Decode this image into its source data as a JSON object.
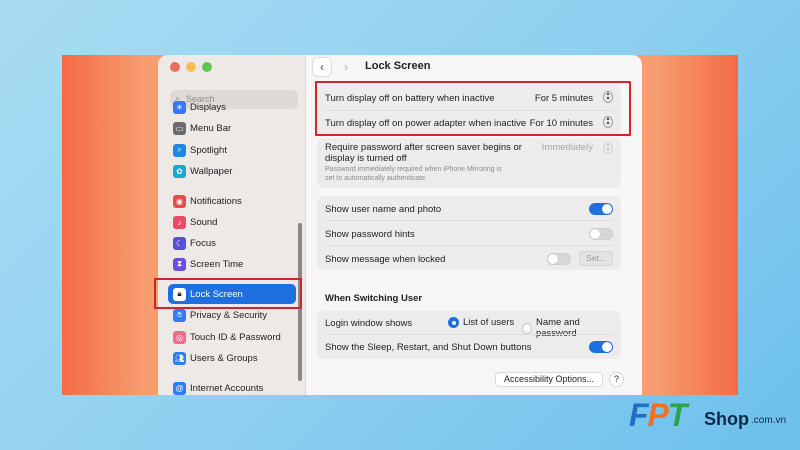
{
  "window": {
    "title": "Lock Screen",
    "search_placeholder": "Search"
  },
  "sidebar": {
    "items": [
      {
        "label": "Displays",
        "icon": "sun-icon",
        "color": "#2f7cf6"
      },
      {
        "label": "Menu Bar",
        "icon": "menubar-icon",
        "color": "#6b6b6b"
      },
      {
        "label": "Spotlight",
        "icon": "magnifier-icon",
        "color": "#1e88e5"
      },
      {
        "label": "Wallpaper",
        "icon": "flower-icon",
        "color": "#18a7d6"
      },
      {
        "label": "Notifications",
        "icon": "bell-icon",
        "color": "#e94a4a"
      },
      {
        "label": "Sound",
        "icon": "speaker-icon",
        "color": "#ec4a6a"
      },
      {
        "label": "Focus",
        "icon": "moon-icon",
        "color": "#5b4fd6"
      },
      {
        "label": "Screen Time",
        "icon": "hourglass-icon",
        "color": "#6a4fd6"
      },
      {
        "label": "Lock Screen",
        "icon": "lock-icon",
        "color": "#1e1e1e",
        "active": true
      },
      {
        "label": "Privacy & Security",
        "icon": "hand-icon",
        "color": "#2f7cf6"
      },
      {
        "label": "Touch ID & Password",
        "icon": "fingerprint-icon",
        "color": "#ef6d8a"
      },
      {
        "label": "Users & Groups",
        "icon": "users-icon",
        "color": "#2f7cf6"
      },
      {
        "label": "Internet Accounts",
        "icon": "at-icon",
        "color": "#2f7cf6"
      }
    ]
  },
  "display": {
    "battery_label": "Turn display off on battery when inactive",
    "battery_value": "For 5 minutes",
    "adapter_label": "Turn display off on power adapter when inactive",
    "adapter_value": "For 10 minutes"
  },
  "password": {
    "label_line1": "Require password after screen saver begins or",
    "label_line2": "display is turned off",
    "value": "Immediately",
    "note_line1": "Password immediately required when iPhone Mirroring is",
    "note_line2": "set to automatically authenticate."
  },
  "toggles": {
    "show_user": {
      "label": "Show user name and photo",
      "on": true
    },
    "show_hints": {
      "label": "Show password hints",
      "on": false
    },
    "show_message": {
      "label": "Show message when locked",
      "on": false,
      "set_label": "Set..."
    }
  },
  "switching": {
    "title": "When Switching User",
    "login_label": "Login window shows",
    "option_list": "List of users",
    "option_name": "Name and password",
    "selected": "List of users",
    "buttons_label": "Show the Sleep, Restart, and Shut Down buttons",
    "buttons_on": true
  },
  "footer": {
    "accessibility_label": "Accessibility Options...",
    "help_label": "?"
  },
  "brand": {
    "f": "F",
    "p": "P",
    "t": "T",
    "shop": "Shop",
    "domain": ".com.vn"
  },
  "colors": {
    "accent": "#1e6fe0",
    "highlight": "#d6222b"
  }
}
